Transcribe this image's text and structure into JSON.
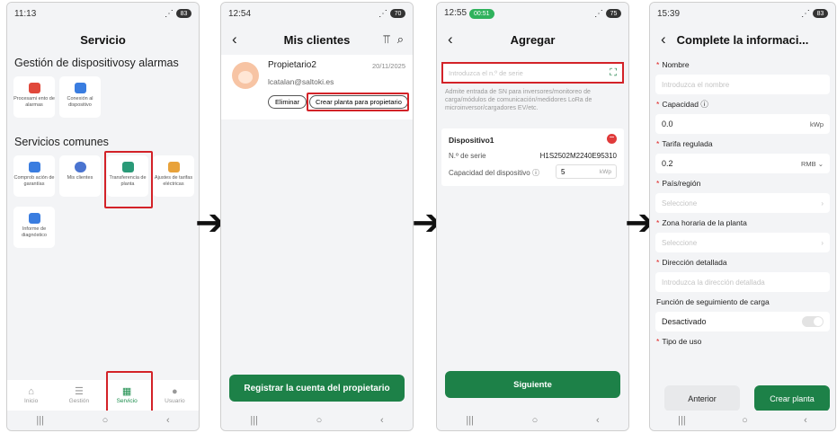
{
  "s1": {
    "time": "11:13",
    "bat": "83",
    "title": "Servicio",
    "sec1": "Gestión de dispositivosy alarmas",
    "sec2": "Servicios comunes",
    "t1": "Procesami ento de alarmas",
    "t2": "Conexión al dispositivo",
    "t3": "Comprob ación de garantías",
    "t4": "Mis clientes",
    "t5": "Transferencia de planta",
    "t6": "Ajustes de tarifas eléctricas",
    "t7": "Informe de diagnóstico",
    "tab1": "Inicio",
    "tab2": "Gestión",
    "tab3": "Servicio",
    "tab4": "Usuario"
  },
  "s2": {
    "time": "12:54",
    "bat": "70",
    "title": "Mis clientes",
    "name": "Propietario2",
    "date": "20/11/2025",
    "email": "lcatalan@saltoki.es",
    "del": "Eliminar",
    "create": "Crear planta para propietario",
    "reg": "Registrar la cuenta del propietario"
  },
  "s3": {
    "time": "12:55",
    "bat": "75",
    "pill": "00:51",
    "title": "Agregar",
    "ph": "Introduzca el n.º de serie",
    "help": "Admite entrada de SN para inversores/monitoreo de carga/módulos de comunicación/medidores LoRa de microinversor/cargadores EV/etc.",
    "dev": "Dispositivo1",
    "snl": "N.º de serie",
    "sn": "H1S2502M2240E95310",
    "capl": "Capacidad del dispositivo",
    "cap": "5",
    "unit": "kWp",
    "next": "Siguiente"
  },
  "s4": {
    "time": "15:39",
    "bat": "83",
    "title": "Complete la informaci...",
    "nombre": "Nombre",
    "nombre_ph": "Introduzca el nombre",
    "capacidad": "Capacidad",
    "cap_v": "0.0",
    "cap_u": "kWp",
    "tarifa": "Tarifa regulada",
    "tar_v": "0.2",
    "tar_u": "RMB",
    "pais": "País/región",
    "sel": "Seleccione",
    "zona": "Zona horaria de la planta",
    "dir": "Dirección detallada",
    "dir_ph": "Introduzca la dirección detallada",
    "func": "Función de seguimiento de carga",
    "desact": "Desactivado",
    "tipo": "Tipo de uso",
    "ant": "Anterior",
    "crear": "Crear planta"
  },
  "colors": {
    "green": "#1d8148",
    "red": "#d32228"
  }
}
